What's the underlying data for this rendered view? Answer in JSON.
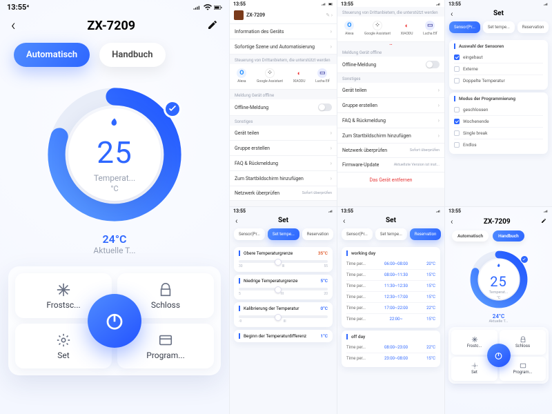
{
  "status": {
    "time": "13:55",
    "time_small": "13:55"
  },
  "main": {
    "title": "ZX-7209",
    "mode_auto": "Automatisch",
    "mode_manual": "Handbuch",
    "temp_value": "25",
    "temp_label": "Temperat...",
    "temp_unit": "°C",
    "current_value": "24°C",
    "current_label": "Aktuelle T...",
    "btn_frost": "Frostsc...",
    "btn_lock": "Schloss",
    "btn_set": "Set",
    "btn_program": "Program..."
  },
  "mini_main": {
    "btn_frost": "Frostc...",
    "btn_lock": "Schloss",
    "btn_set": "Set",
    "btn_program": "Program..."
  },
  "settings1": {
    "device": "ZX-7209",
    "info": "Information des Geräts",
    "scene": "Sofortige Szene und Automatisierung",
    "third_hdr": "Steuerung von Drittanbietern, die unterstützt werden",
    "partners": [
      "Alexa",
      "Google Assistant",
      "XIAODU",
      "Lucha Elf"
    ],
    "offline_hdr": "Meldung Gerät offline",
    "offline": "Offline-Meldung",
    "other_hdr": "Sonstiges",
    "share": "Gerät teilen",
    "group": "Gruppe erstellen",
    "faq": "FAQ & Rückmeldung",
    "home": "Zum Startbildschirm hinzufügen",
    "net": "Netzwerk überprüfen",
    "net_v": "Sofort überprüfen"
  },
  "settings2": {
    "firmware": "Firmware-Update",
    "firmware_v": "Aktuellste Version ist inst...",
    "remove": "Das Gerät entfernen"
  },
  "set_title": "Set",
  "set_tabs": {
    "sensor": "Sensor(Pr...",
    "temp": "Set tempe...",
    "res": "Reservation"
  },
  "sensors": {
    "h1": "Auswahl der Sensoren",
    "o1": "eingebaut",
    "o2": "Externe",
    "o3": "Doppelte Temperatur",
    "h2": "Modus der Programmierung",
    "p1": "geschlossen",
    "p2": "Wochenende",
    "p3": "Single break",
    "p4": "Endlos"
  },
  "limits": {
    "upper_l": "Obere Temperaturgrenze",
    "upper_v": "35°C",
    "upper_min": "30",
    "upper_mid": "III",
    "upper_max": "55",
    "lower_l": "Niedrige Temperaturgrenze",
    "lower_v": "5°C",
    "lower_min": "5",
    "lower_mid": "III",
    "lower_max": "20",
    "cal_l": "Kalibrierung der Temperatur",
    "cal_v": "0°C",
    "cal_min": "-9",
    "cal_mid": "III",
    "cal_max": "",
    "diff_l": "Beginn der Temperaturdifferenz",
    "diff_v": "1°C"
  },
  "sched": {
    "work_h": "working day",
    "label": "Time per...",
    "rows_work": [
      {
        "t": "06:00~08:00",
        "v": "20°C"
      },
      {
        "t": "08:00~11:30",
        "v": "15°C"
      },
      {
        "t": "11:30~12:30",
        "v": "15°C"
      },
      {
        "t": "12:30~17:00",
        "v": "15°C"
      },
      {
        "t": "17:00~22:00",
        "v": "22°C"
      },
      {
        "t": "22:00~",
        "v": "15°C"
      }
    ],
    "off_h": "off day",
    "rows_off": [
      {
        "t": "08:00~23:00",
        "v": "22°C"
      },
      {
        "t": "23:00~08:00",
        "v": "15°C"
      }
    ]
  }
}
